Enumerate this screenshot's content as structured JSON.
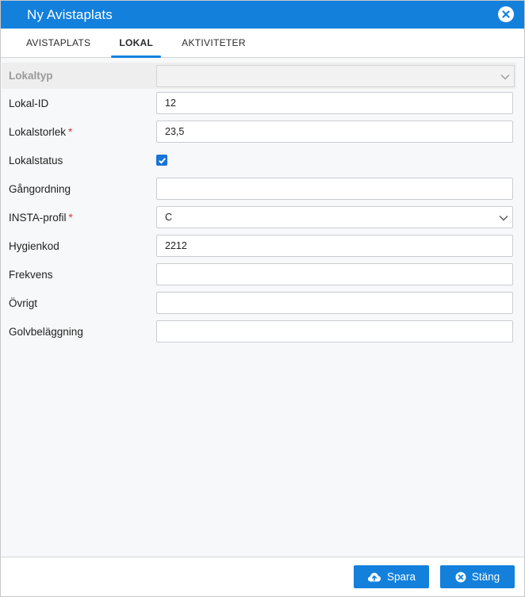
{
  "window": {
    "title": "Ny Avistaplats"
  },
  "tabs": [
    {
      "label": "AVISTAPLATS"
    },
    {
      "label": "LOKAL"
    },
    {
      "label": "AKTIVITETER"
    }
  ],
  "form": {
    "lokaltyp": {
      "label": "Lokaltyp",
      "value": ""
    },
    "lokal_id": {
      "label": "Lokal-ID",
      "value": "12"
    },
    "lokalstorlek": {
      "label": "Lokalstorlek",
      "required_mark": "*",
      "value": "23,5"
    },
    "lokalstatus": {
      "label": "Lokalstatus",
      "checked": true
    },
    "gangordning": {
      "label": "Gångordning",
      "value": ""
    },
    "insta_profil": {
      "label": "INSTA-profil",
      "required_mark": "*",
      "value": "C"
    },
    "hygienkod": {
      "label": "Hygienkod",
      "value": "2212"
    },
    "frekvens": {
      "label": "Frekvens",
      "value": ""
    },
    "ovrigt": {
      "label": "Övrigt",
      "value": ""
    },
    "golvbelaggning": {
      "label": "Golvbeläggning",
      "value": ""
    }
  },
  "footer": {
    "save_label": "Spara",
    "close_label": "Stäng"
  },
  "icons": {
    "close": "close-circle-icon",
    "save": "cloud-upload-icon",
    "cancel": "close-circle-icon",
    "dropdown": "chevron-down-icon",
    "check": "checkmark-icon"
  },
  "colors": {
    "accent": "#1380dc",
    "required": "#d9363e"
  }
}
